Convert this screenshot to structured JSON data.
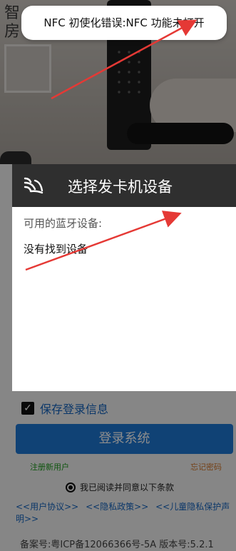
{
  "background_app": {
    "banner_chars": [
      "智",
      "房"
    ],
    "remember_label": "保存登录信息",
    "login_button": "登录系统",
    "register_link": "注册新用户",
    "forgot_link": "忘记密码",
    "agree_text": "我已阅读并同意以下条款",
    "policy_links": [
      "<<用户协议>>",
      "<<隐私政策>>",
      "<<儿童隐私保护声明>>"
    ],
    "footer": "备案号:粤ICP备12066366号-5A   版本号:5.2.1"
  },
  "toast": {
    "text": "NFC 初使化错误:NFC 功能未打开"
  },
  "dialog": {
    "title": "选择发卡机设备",
    "subtitle": "可用的蓝牙设备:",
    "empty_message": "没有找到设备",
    "icon": "nfc-signal-icon"
  },
  "colors": {
    "dialog_header": "#2f2f2f",
    "login_button": "#1e78d6",
    "annotation_arrow": "#e53935"
  }
}
